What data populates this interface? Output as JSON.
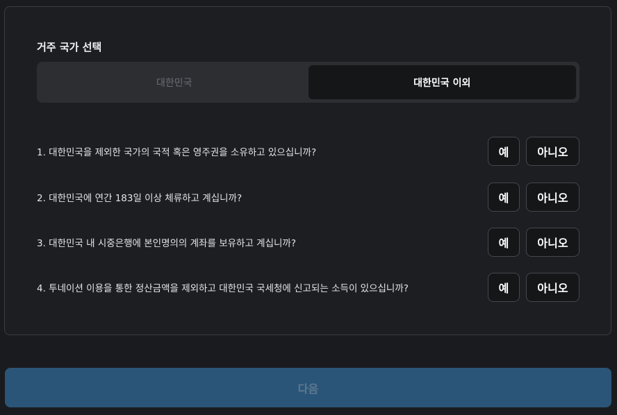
{
  "residence": {
    "title": "거주 국가 선택",
    "options": [
      "대한민국",
      "대한민국 이외"
    ],
    "selected": "대한민국 이외"
  },
  "questions": [
    {
      "text": "1. 대한민국을 제외한 국가의 국적 혹은 영주권을 소유하고 있으십니까?",
      "yes": "예",
      "no": "아니오"
    },
    {
      "text": "2. 대한민국에 연간 183일 이상 체류하고 계십니까?",
      "yes": "예",
      "no": "아니오"
    },
    {
      "text": "3. 대한민국 내 시중은행에 본인명의의 계좌를 보유하고 계십니까?",
      "yes": "예",
      "no": "아니오"
    },
    {
      "text": "4. 투네이션 이용을 통한 정산금액을 제외하고 대한민국 국세청에 신고되는 소득이 있으십니까?",
      "yes": "예",
      "no": "아니오"
    }
  ],
  "next_button": "다음",
  "colors": {
    "background": "#1a1b1e",
    "panel": "#1d1e21",
    "segment_track": "#2c2e32",
    "segment_active": "#151618",
    "next_button": "#2b5578"
  }
}
